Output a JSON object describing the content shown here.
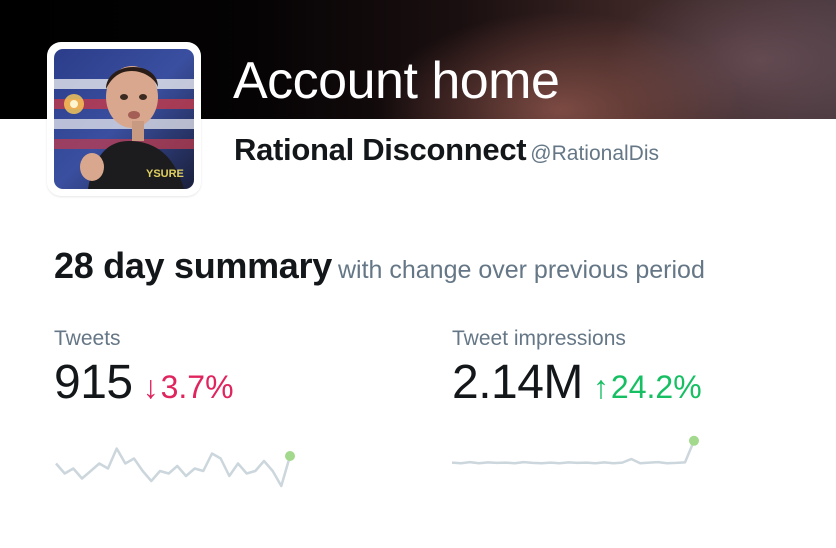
{
  "header": {
    "title": "Account home"
  },
  "profile": {
    "display_name": "Rational Disconnect",
    "handle": "@RationalDis"
  },
  "summary": {
    "title": "28 day summary",
    "subtitle": "with change over previous period"
  },
  "metrics": [
    {
      "label": "Tweets",
      "value": "915",
      "change": "3.7%",
      "direction": "down",
      "arrow_icon": "arrow-down-icon",
      "sparkline": [
        0.45,
        0.25,
        0.35,
        0.15,
        0.3,
        0.45,
        0.35,
        0.75,
        0.45,
        0.55,
        0.3,
        0.1,
        0.3,
        0.25,
        0.4,
        0.2,
        0.35,
        0.3,
        0.65,
        0.55,
        0.2,
        0.45,
        0.25,
        0.3,
        0.5,
        0.3,
        0.0,
        0.6
      ]
    },
    {
      "label": "Tweet impressions",
      "value": "2.14M",
      "change": "24.2%",
      "direction": "up",
      "arrow_icon": "arrow-up-icon",
      "sparkline": [
        0.12,
        0.1,
        0.14,
        0.1,
        0.13,
        0.11,
        0.12,
        0.1,
        0.14,
        0.11,
        0.1,
        0.12,
        0.1,
        0.13,
        0.11,
        0.12,
        0.1,
        0.13,
        0.1,
        0.12,
        0.25,
        0.1,
        0.12,
        0.14,
        0.1,
        0.11,
        0.13,
        0.9
      ]
    }
  ],
  "colors": {
    "negative": "#e0245e",
    "positive": "#17bf63",
    "sparkline": "#ccd6dd",
    "sparkline_end": "#a3d98c"
  }
}
